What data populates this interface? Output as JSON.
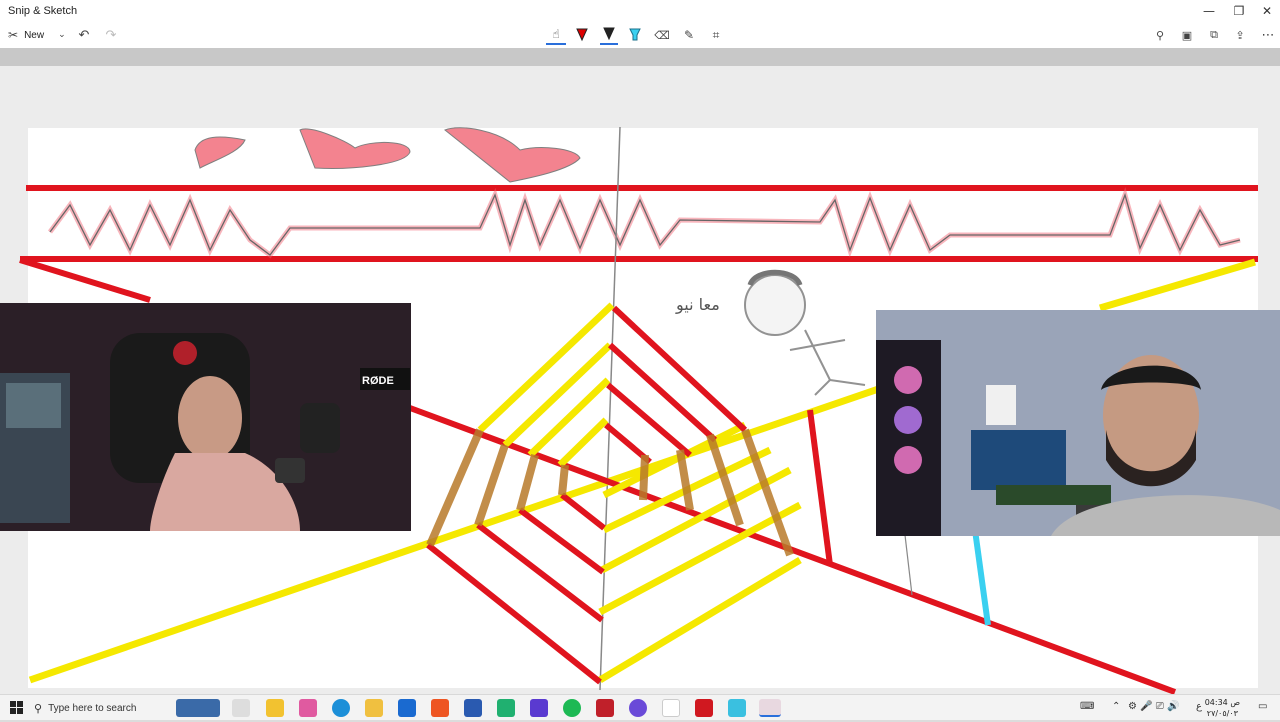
{
  "app": {
    "title": "Snip & Sketch"
  },
  "window_controls": {
    "minimize": "—",
    "restore": "❐",
    "close": "✕"
  },
  "toolbar": {
    "new_label": "New",
    "more_label": "⋯"
  },
  "taskbar": {
    "search_placeholder": "Type here to search",
    "time": "04:34 ص",
    "date": "٢٧/٠٥/٠٣",
    "language": "ع"
  },
  "canvas_text": {
    "handwriting": "معا نیو"
  },
  "colors": {
    "red": "#e0141e",
    "yellow": "#f5e800",
    "brown": "#b87a2a",
    "cyan": "#3ad0f0"
  }
}
